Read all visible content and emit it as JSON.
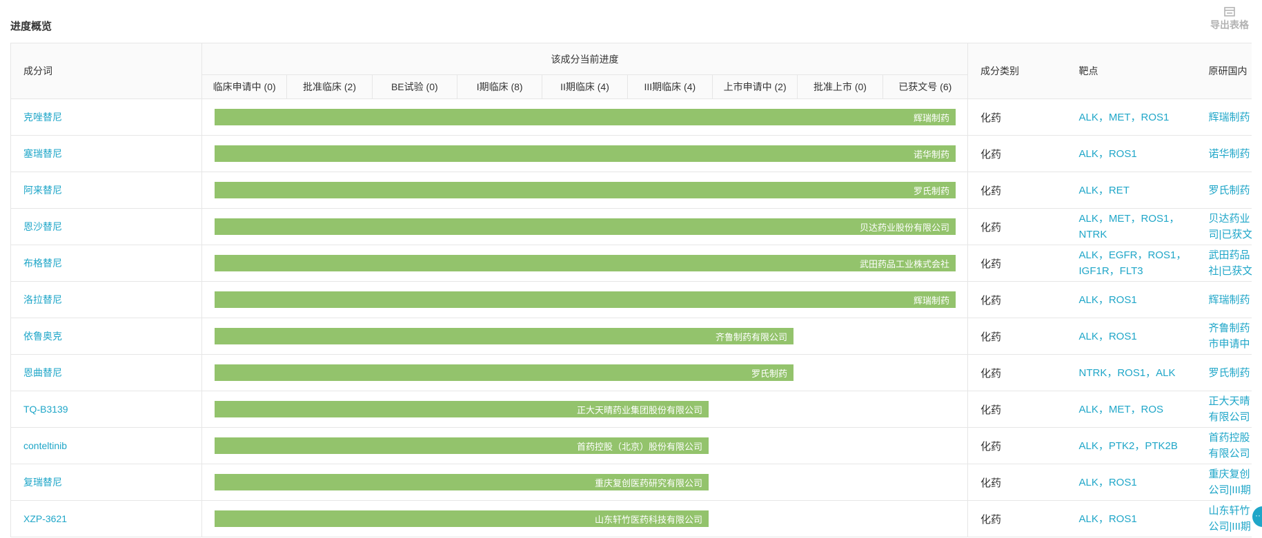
{
  "page": {
    "title": "进度概览",
    "export_label": "导出表格",
    "export_icon": "export-table-icon"
  },
  "table": {
    "headers": {
      "component": "成分词",
      "progress_group": "该成分当前进度",
      "type": "成分类别",
      "target": "靶点",
      "origin": "原研国内"
    },
    "stages": [
      "临床申请中 (0)",
      "批准临床 (2)",
      "BE试验 (0)",
      "I期临床 (8)",
      "II期临床 (4)",
      "III期临床 (4)",
      "上市申请中 (2)",
      "批准上市 (0)",
      "已获文号 (6)"
    ],
    "rows": [
      {
        "component": "克唑替尼",
        "company": "辉瑞制药",
        "progress": 9,
        "type": "化药",
        "target": "ALK，MET，ROS1",
        "origin": "辉瑞制药"
      },
      {
        "component": "塞瑞替尼",
        "company": "诺华制药",
        "progress": 9,
        "type": "化药",
        "target": "ALK，ROS1",
        "origin": "诺华制药"
      },
      {
        "component": "阿来替尼",
        "company": "罗氏制药",
        "progress": 9,
        "type": "化药",
        "target": "ALK，RET",
        "origin": "罗氏制药"
      },
      {
        "component": "恩沙替尼",
        "company": "贝达药业股份有限公司",
        "progress": 9,
        "type": "化药",
        "target": "ALK，MET，ROS1，NTRK",
        "origin": "贝达药业\n司|已获文"
      },
      {
        "component": "布格替尼",
        "company": "武田药品工业株式会社",
        "progress": 9,
        "type": "化药",
        "target": "ALK，EGFR，ROS1，IGF1R，FLT3",
        "origin": "武田药品\n社|已获文"
      },
      {
        "component": "洛拉替尼",
        "company": "辉瑞制药",
        "progress": 9,
        "type": "化药",
        "target": "ALK，ROS1",
        "origin": "辉瑞制药"
      },
      {
        "component": "依鲁奥克",
        "company": "齐鲁制药有限公司",
        "progress": 7,
        "type": "化药",
        "target": "ALK，ROS1",
        "origin": "齐鲁制药\n市申请中"
      },
      {
        "component": "恩曲替尼",
        "company": "罗氏制药",
        "progress": 7,
        "type": "化药",
        "target": "NTRK，ROS1，ALK",
        "origin": "罗氏制药"
      },
      {
        "component": "TQ-B3139",
        "company": "正大天晴药业集团股份有限公司",
        "progress": 6,
        "type": "化药",
        "target": "ALK，MET，ROS",
        "origin": "正大天晴\n有限公司"
      },
      {
        "component": "conteltinib",
        "company": "首药控股（北京）股份有限公司",
        "progress": 6,
        "type": "化药",
        "target": "ALK，PTK2，PTK2B",
        "origin": "首药控股\n有限公司"
      },
      {
        "component": "复瑞替尼",
        "company": "重庆复创医药研究有限公司",
        "progress": 6,
        "type": "化药",
        "target": "ALK，ROS1",
        "origin": "重庆复创\n公司|III期"
      },
      {
        "component": "XZP-3621",
        "company": "山东轩竹医药科技有限公司",
        "progress": 6,
        "type": "化药",
        "target": "ALK，ROS1",
        "origin": "山东轩竹\n公司|III期"
      }
    ]
  },
  "chat_bubble_icon": "chat-bubble-icon",
  "chat_bubble_label": "··"
}
